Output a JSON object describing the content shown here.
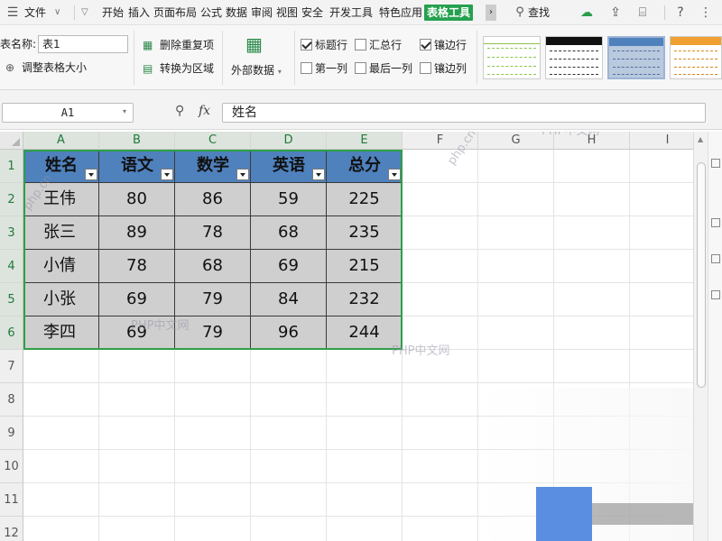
{
  "menubar": {
    "file": "文件",
    "tabs": [
      "开始",
      "插入",
      "页面布局",
      "公式",
      "数据",
      "审阅",
      "视图",
      "安全",
      "开发工具",
      "特色应用",
      "表格工具"
    ],
    "active_tab": "表格工具",
    "search": "查找"
  },
  "ribbon": {
    "table_name_label": "表名称:",
    "table_name_value": "表1",
    "resize_table": "调整表格大小",
    "remove_duplicates": "删除重复项",
    "convert_to_range": "转换为区域",
    "external_data": "外部数据",
    "options": [
      {
        "label": "标题行",
        "checked": true
      },
      {
        "label": "汇总行",
        "checked": false
      },
      {
        "label": "镶边行",
        "checked": true
      },
      {
        "label": "第一列",
        "checked": false
      },
      {
        "label": "最后一列",
        "checked": false
      },
      {
        "label": "镶边列",
        "checked": false
      }
    ],
    "style_colors": [
      "#8bc34a",
      "#111111",
      "#4f81bd",
      "#f0a030"
    ]
  },
  "formula_bar": {
    "cell_ref": "A1",
    "fx": "fx",
    "content": "姓名"
  },
  "grid": {
    "columns": [
      "A",
      "B",
      "C",
      "D",
      "E",
      "F",
      "G",
      "H",
      "I"
    ],
    "rows": [
      "1",
      "2",
      "3",
      "4",
      "5",
      "6",
      "7",
      "8",
      "9",
      "10",
      "11",
      "12"
    ]
  },
  "table": {
    "headers": [
      "姓名",
      "语文",
      "数学",
      "英语",
      "总分"
    ],
    "rows": [
      [
        "王伟",
        "80",
        "86",
        "59",
        "225"
      ],
      [
        "张三",
        "89",
        "78",
        "68",
        "235"
      ],
      [
        "小倩",
        "78",
        "68",
        "69",
        "215"
      ],
      [
        "小张",
        "69",
        "79",
        "84",
        "232"
      ],
      [
        "李四",
        "69",
        "79",
        "96",
        "244"
      ]
    ],
    "header_color": "#4f81bd",
    "body_color": "#cfcfcf",
    "outline_color": "#2f9e48"
  },
  "watermarks": [
    "PHP中文网",
    "php.cn"
  ]
}
